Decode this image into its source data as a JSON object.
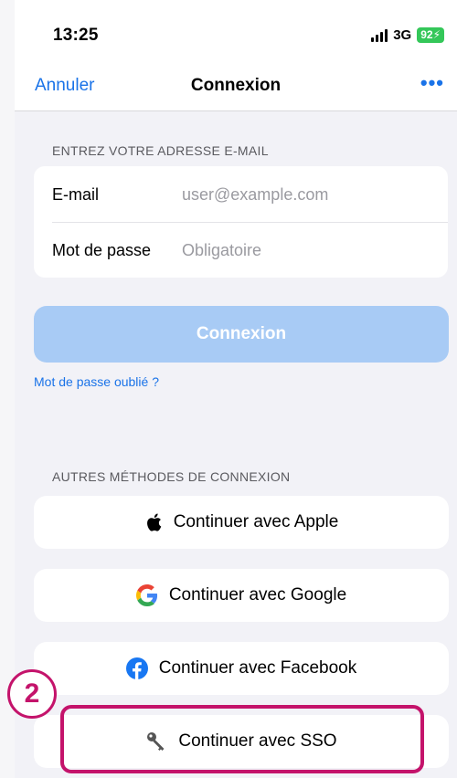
{
  "status_bar": {
    "time": "13:25",
    "network": "3G",
    "battery": "92"
  },
  "nav": {
    "cancel_label": "Annuler",
    "title": "Connexion",
    "more_label": "•••"
  },
  "email_section": {
    "header": "ENTREZ VOTRE ADRESSE E-MAIL",
    "email_label": "E-mail",
    "email_placeholder": "user@example.com",
    "email_value": "",
    "password_label": "Mot de passe",
    "password_placeholder": "Obligatoire",
    "password_value": ""
  },
  "login_button_label": "Connexion",
  "forgot_password_label": "Mot de passe oublié ?",
  "other_methods": {
    "header": "AUTRES MÉTHODES DE CONNEXION",
    "apple_label": "Continuer avec Apple",
    "google_label": "Continuer avec Google",
    "facebook_label": "Continuer avec Facebook",
    "sso_label": "Continuer avec SSO"
  },
  "annotation": {
    "step_number": "2",
    "color": "#c4136b"
  },
  "colors": {
    "accent": "#1a73e8",
    "login_button_disabled": "#a8cbf5",
    "battery": "#34c759",
    "facebook": "#1877f2"
  },
  "icons": [
    "signal-icon",
    "battery-icon",
    "more-icon",
    "apple-icon",
    "google-icon",
    "facebook-icon",
    "key-icon"
  ]
}
